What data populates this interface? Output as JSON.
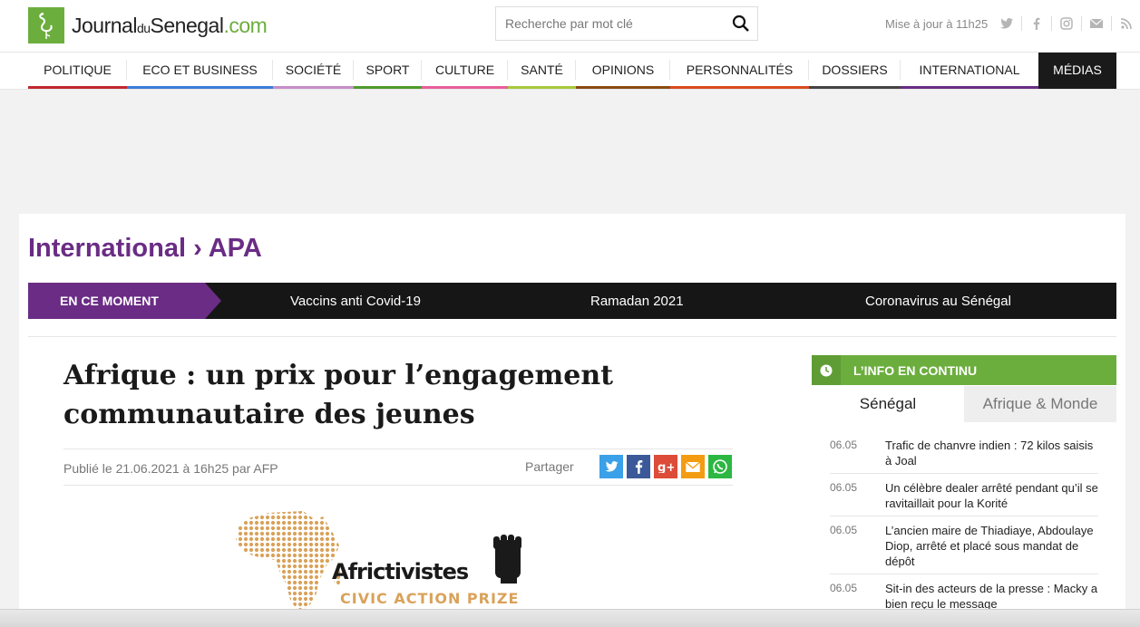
{
  "header": {
    "logo": {
      "part1": "Journal",
      "part2": "du",
      "part3": "Senegal",
      "part4": ".com"
    },
    "search_placeholder": "Recherche par mot clé",
    "update_text": "Mise à jour à 11h25"
  },
  "nav": {
    "items": [
      {
        "label": "POLITIQUE",
        "color": "#c0272d"
      },
      {
        "label": "ECO ET BUSINESS",
        "color": "#3b7dd8"
      },
      {
        "label": "SOCIÉTÉ",
        "color": "#c58ec7"
      },
      {
        "label": "SPORT",
        "color": "#4e9a2c"
      },
      {
        "label": "CULTURE",
        "color": "#e85f9a"
      },
      {
        "label": "SANTÉ",
        "color": "#a8c83a"
      },
      {
        "label": "OPINIONS",
        "color": "#8a4a12"
      },
      {
        "label": "PERSONNALITÉS",
        "color": "#d94a1e"
      },
      {
        "label": "DOSSIERS",
        "color": "#444444"
      },
      {
        "label": "INTERNATIONAL",
        "color": "#6a2c85"
      },
      {
        "label": "MÉDIAS",
        "color": "#1a1a1a"
      }
    ]
  },
  "breadcrumb": {
    "section": "International",
    "separator": " › ",
    "sub": "APA"
  },
  "moment": {
    "label": "EN CE MOMENT",
    "links": [
      "Vaccins anti Covid-19",
      "Ramadan 2021",
      "Coronavirus au Sénégal"
    ]
  },
  "article": {
    "title": "Afrique : un prix pour l’engagement communautaire des jeunes",
    "meta": "Publié le 21.06.2021 à 16h25 par AFP",
    "share_label": "Partager",
    "image": {
      "brand": "Africtivistes",
      "subtitle": "CIVIC ACTION PRIZE"
    }
  },
  "sidebar": {
    "header": "L’INFO EN CONTINU",
    "tabs": [
      "Sénégal",
      "Afrique & Monde"
    ],
    "news": [
      {
        "date": "06.05",
        "title": "Trafic de chanvre indien : 72 kilos saisis à Joal"
      },
      {
        "date": "06.05",
        "title": "Un célèbre dealer arrêté pendant qu’il se ravitaillait pour la Korité"
      },
      {
        "date": "06.05",
        "title": "L’ancien maire de Thiadiaye, Abdoulaye Diop, arrêté et placé sous mandat de dépôt"
      },
      {
        "date": "06.05",
        "title": "Sit-in des acteurs de la presse : Macky a bien reçu le message"
      }
    ]
  },
  "colors": {
    "brand_green": "#6cae3e",
    "purple": "#6a2c85",
    "dark": "#161616"
  }
}
